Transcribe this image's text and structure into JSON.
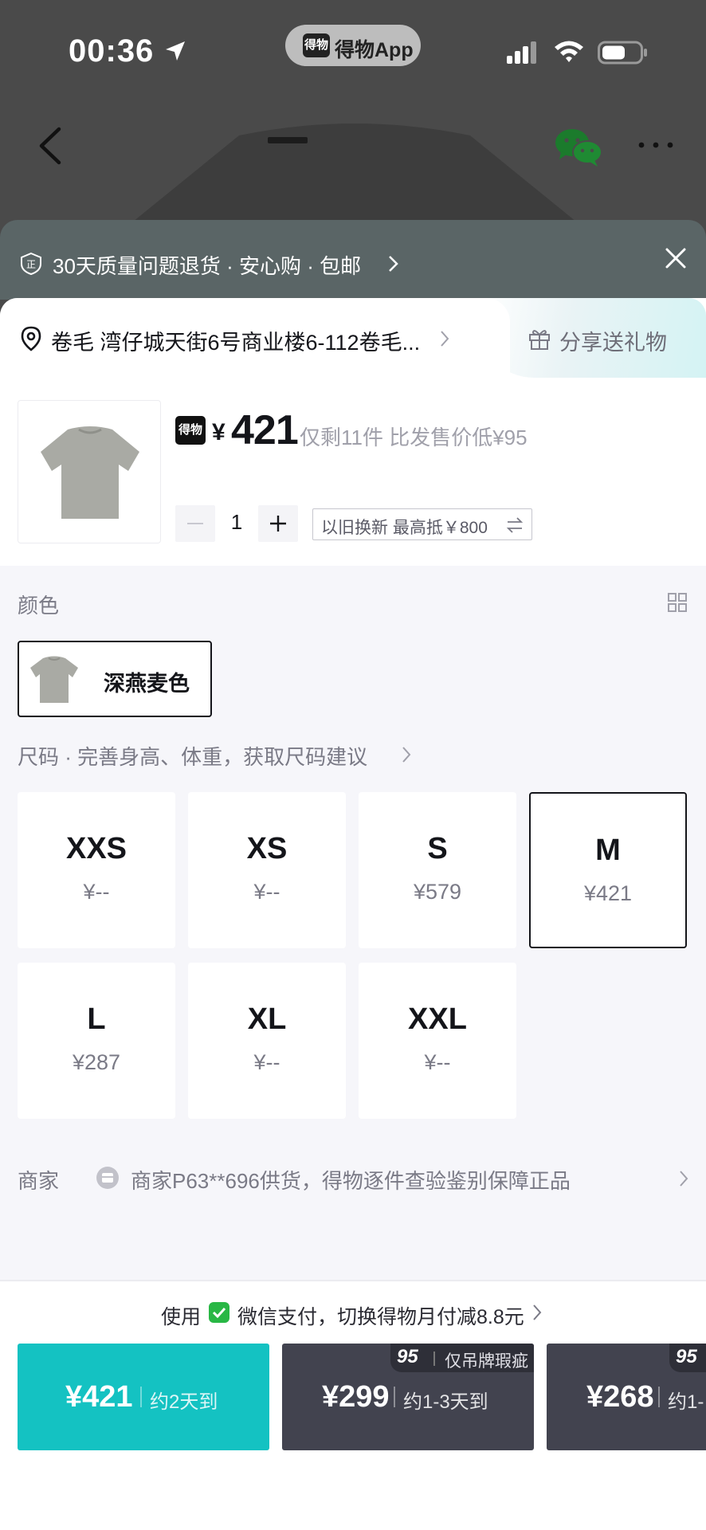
{
  "status_bar": {
    "time": "00:36",
    "app_name": "得物App",
    "app_logo": "得物"
  },
  "service_banner": {
    "text": "30天质量问题退货 · 安心购 · 包邮"
  },
  "address": {
    "text": "卷毛 湾仔城天街6号商业楼6-112卷毛..."
  },
  "share": {
    "label": "分享送礼物"
  },
  "product": {
    "price_logo": "得物",
    "currency": "¥",
    "price": "421",
    "note": "仅剩11件 比发售价低¥95",
    "quantity": "1",
    "trade_in": "以旧换新 最高抵￥800"
  },
  "color_section": {
    "label": "颜色",
    "options": [
      {
        "name": "深燕麦色",
        "selected": true
      }
    ]
  },
  "size_section": {
    "label": "尺码 · 完善身高、体重，获取尺码建议",
    "sizes": [
      {
        "name": "XXS",
        "price": "¥--"
      },
      {
        "name": "XS",
        "price": "¥--"
      },
      {
        "name": "S",
        "price": "¥579"
      },
      {
        "name": "M",
        "price": "¥421",
        "selected": true
      },
      {
        "name": "L",
        "price": "¥287"
      },
      {
        "name": "XL",
        "price": "¥--"
      },
      {
        "name": "XXL",
        "price": "¥--"
      }
    ]
  },
  "merchant": {
    "label": "商家",
    "text": "商家P63**696供货，得物逐件查验鉴别保障正品"
  },
  "pay_tip": {
    "prefix": "使用",
    "text": "微信支付，切换得物月付减8.8元"
  },
  "buy_options": [
    {
      "price": "¥421",
      "eta": "约2天到",
      "style": "primary"
    },
    {
      "price": "¥299",
      "eta": "约1-3天到",
      "badge": "95",
      "condition": "仅吊牌瑕疵",
      "style": "dark"
    },
    {
      "price": "¥268",
      "eta": "约1-",
      "badge": "95",
      "style": "dark"
    }
  ],
  "colors": {
    "accent": "#14c2c2",
    "dark_button": "#42434f",
    "text": "#14151a",
    "muted": "#7a7a86"
  }
}
